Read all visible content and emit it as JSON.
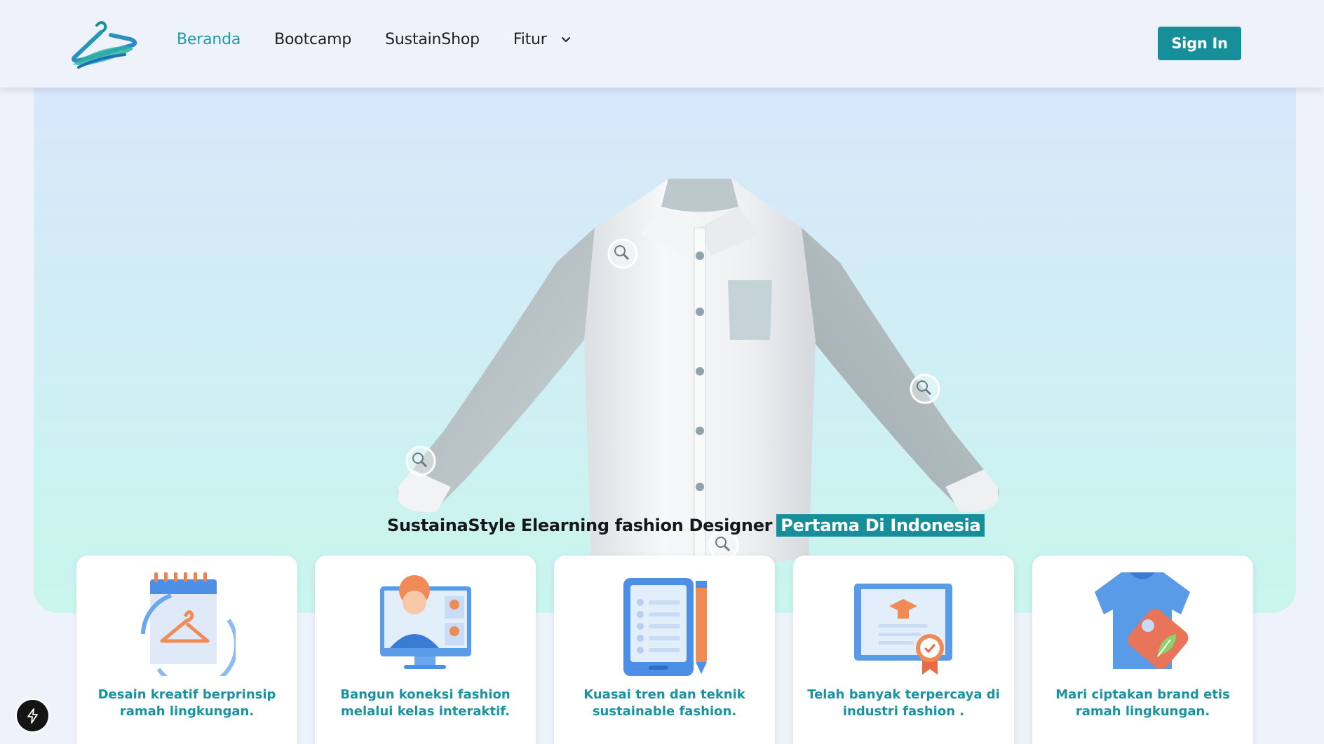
{
  "header": {
    "logo_icon": "hanger-logo-icon",
    "nav": {
      "home": "Beranda",
      "bootcamp": "Bootcamp",
      "shop": "SustainShop",
      "features": "Fitur"
    },
    "sign_in": "Sign In"
  },
  "hero": {
    "headline": "SustainaStyle Elearning fashion Designer",
    "headline_highlight": "Pertama Di Indonesia",
    "hotspot_icon": "magnifier-icon"
  },
  "features": [
    {
      "text": "Desain kreatif berprinsip ramah lingkungan.",
      "icon": "eco-hanger-calendar-icon"
    },
    {
      "text": "Bangun koneksi fashion melalui kelas interaktif.",
      "icon": "online-class-icon"
    },
    {
      "text": "Kuasai tren dan teknik sustainable fashion.",
      "icon": "checklist-pencil-icon"
    },
    {
      "text": "Telah banyak terpercaya di industri fashion .",
      "icon": "certificate-icon"
    },
    {
      "text": "Mari ciptakan brand etis ramah lingkungan.",
      "icon": "shirt-eco-tag-icon"
    }
  ],
  "colors": {
    "accent": "#168f9b",
    "accent_text": "#1e9aa6",
    "page_bg": "#eef2fa"
  },
  "fab_icon": "lightning-icon"
}
